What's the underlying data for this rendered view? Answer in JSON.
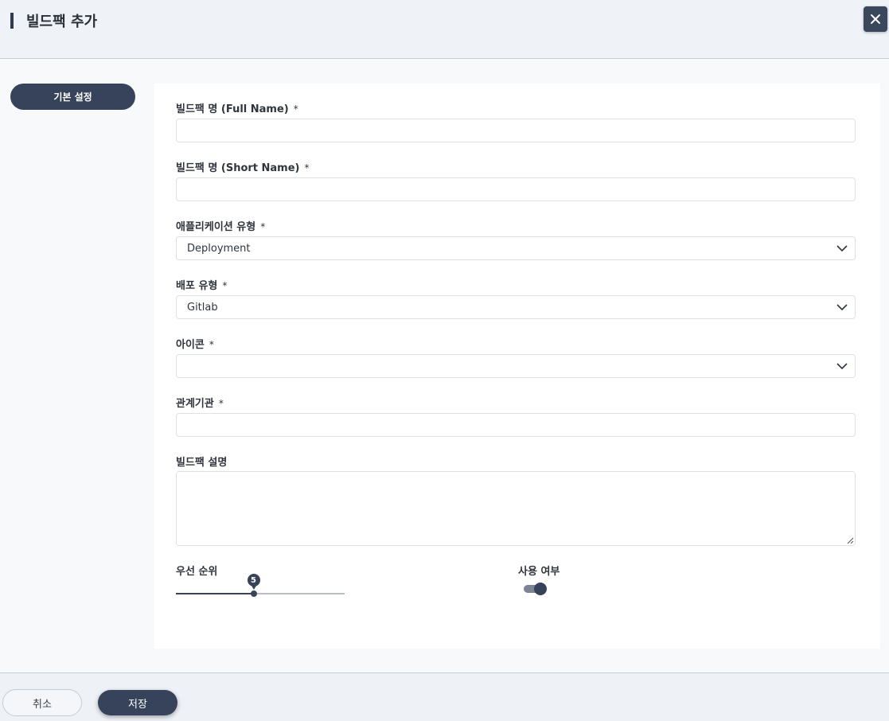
{
  "header": {
    "title": "빌드팩 추가",
    "close_icon": "close-icon"
  },
  "sidebar": {
    "tab_label": "기본 설정"
  },
  "form": {
    "required_mark": "*",
    "full_name": {
      "label": "빌드팩 명 (Full Name)",
      "value": ""
    },
    "short_name": {
      "label": "빌드팩 명 (Short Name)",
      "value": ""
    },
    "app_type": {
      "label": "애플리케이션 유형",
      "value": "Deployment"
    },
    "deploy_type": {
      "label": "배포 유형",
      "value": "Gitlab"
    },
    "icon": {
      "label": "아이콘",
      "value": ""
    },
    "organization": {
      "label": "관계기관",
      "value": ""
    },
    "description": {
      "label": "빌드팩 설명",
      "value": ""
    },
    "priority": {
      "label": "우선 순위",
      "value": "5",
      "fraction": 0.46
    },
    "enabled": {
      "label": "사용 여부",
      "on": true
    }
  },
  "footer": {
    "cancel_label": "취소",
    "save_label": "저장"
  },
  "colors": {
    "accent": "#36435a",
    "header_bg": "#eff3f7"
  }
}
